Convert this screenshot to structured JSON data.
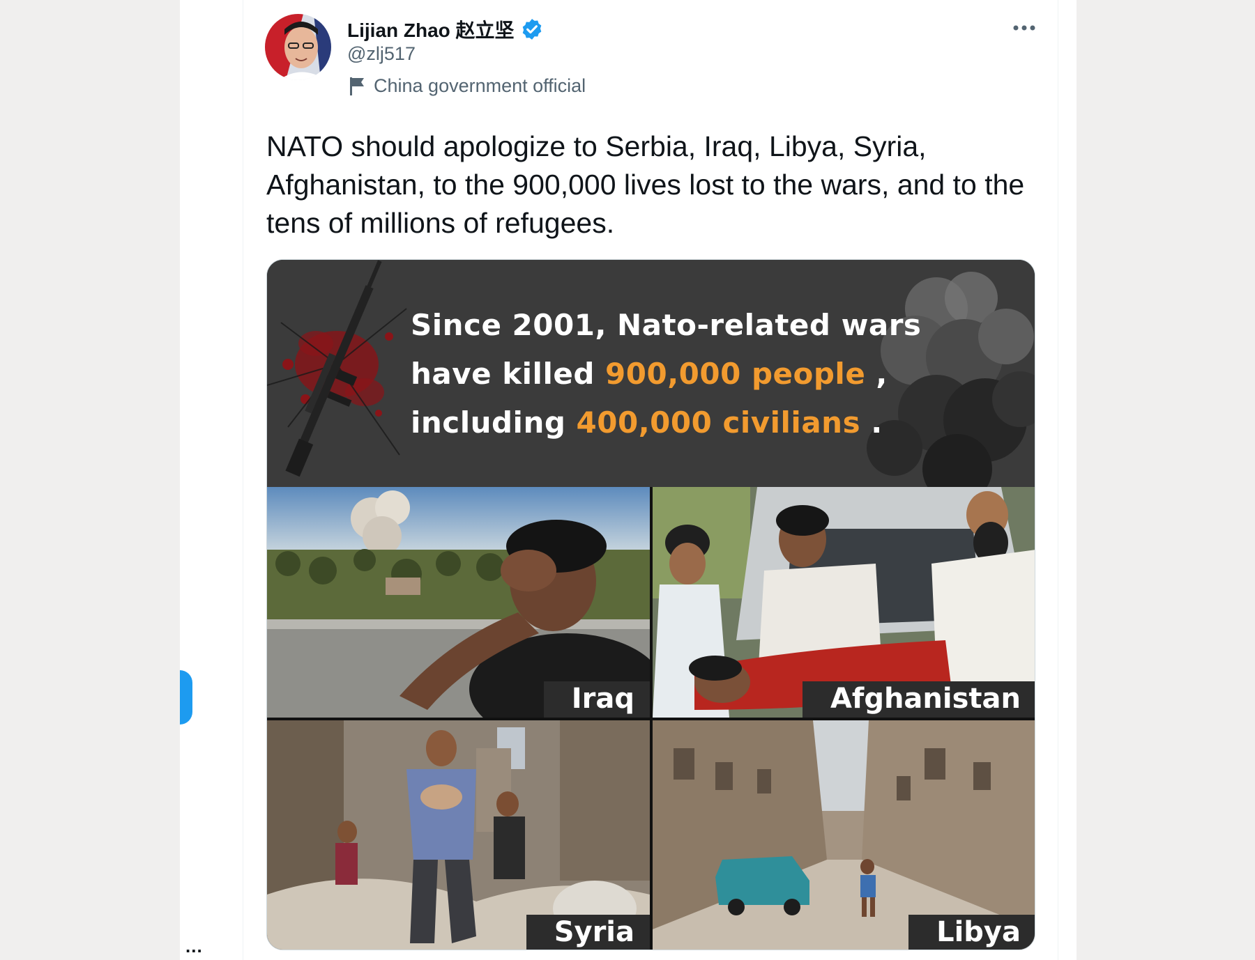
{
  "tweet": {
    "author": {
      "display_name": "Lijian Zhao 赵立坚",
      "handle": "@zlj517",
      "label": "China government official"
    },
    "text": "NATO should apologize to Serbia, Iraq, Libya, Syria, Afghanistan, to the 900,000 lives lost to the wars, and to the tens of millions of refugees."
  },
  "media": {
    "banner": {
      "line1": "Since 2001, Nato-related wars",
      "line2_prefix": "have killed",
      "line2_highlight": "900,000 people",
      "line2_suffix": " ,",
      "line3_prefix": "including",
      "line3_highlight": "400,000 civilians",
      "line3_suffix": " ."
    },
    "panels": [
      "Iraq",
      "Afghanistan",
      "Syria",
      "Libya"
    ]
  },
  "left_rail": {
    "more_label": "..."
  },
  "colors": {
    "accent": "#1d9bf0",
    "highlight": "#f29b2f",
    "text": "#0f1419",
    "secondary": "#536471"
  },
  "icons": [
    "verified-badge-icon",
    "flag-icon",
    "more-options-icon"
  ]
}
